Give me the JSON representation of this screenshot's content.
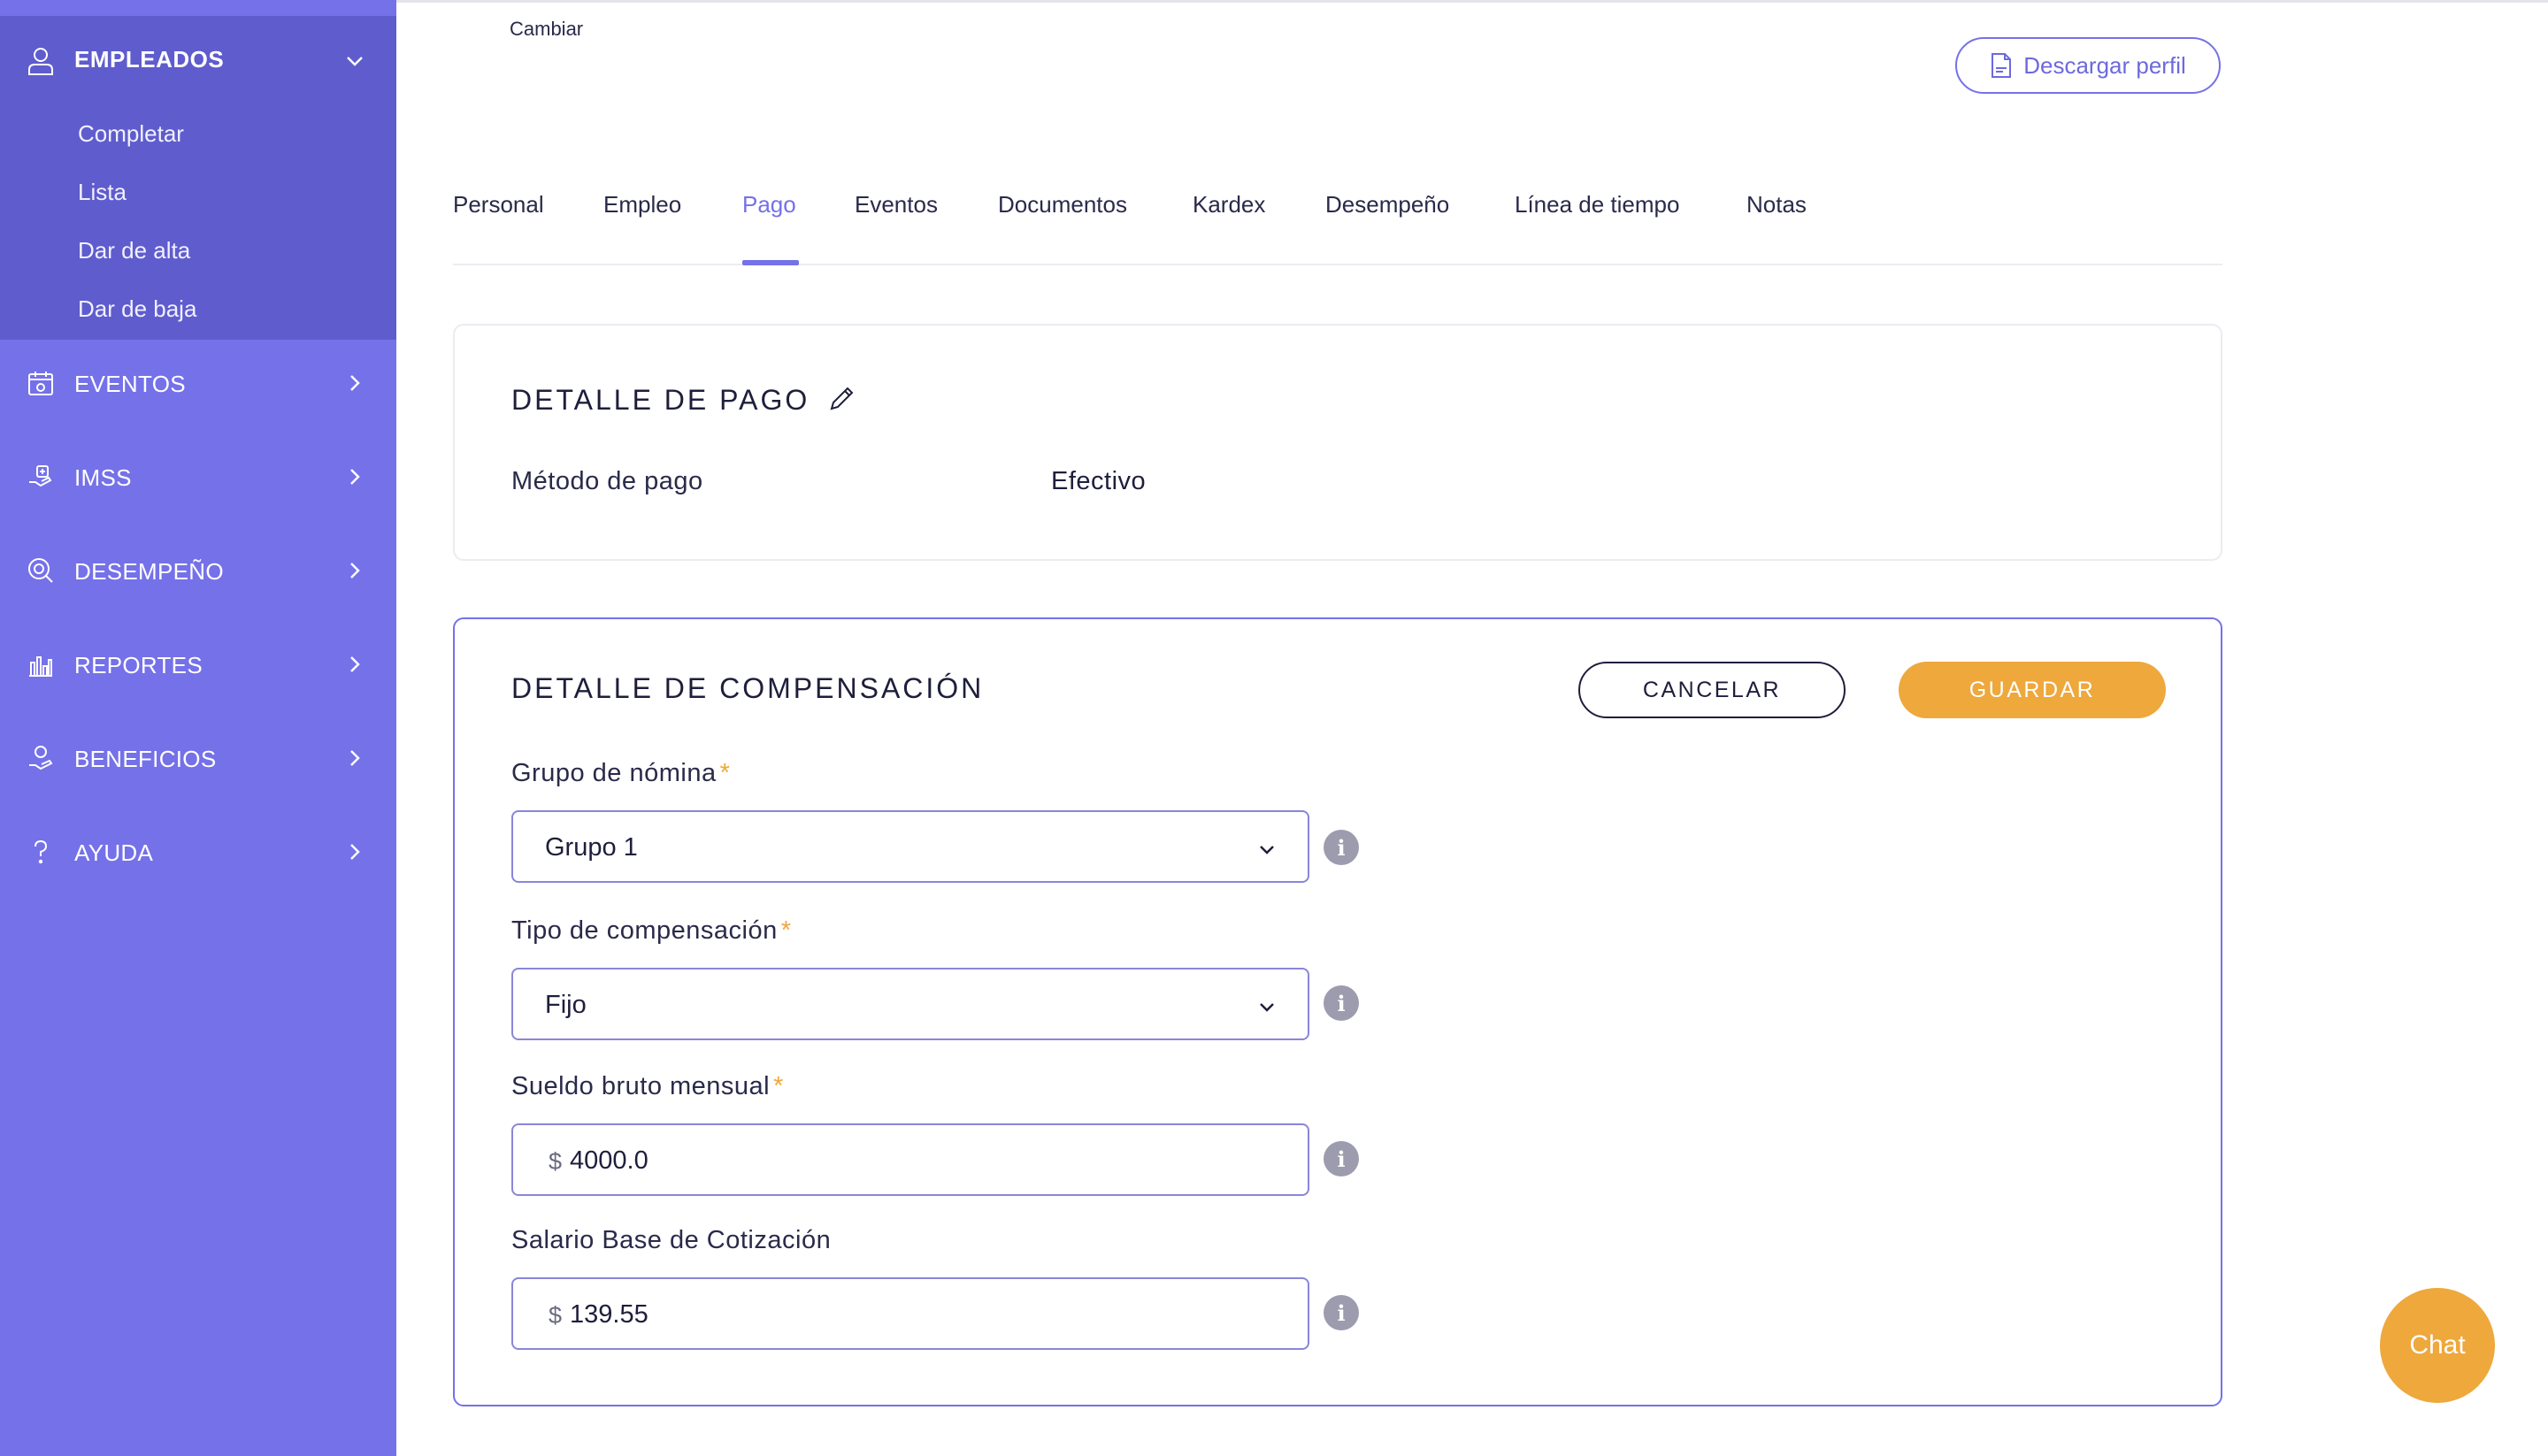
{
  "sidebar": {
    "empleados": {
      "label": "EMPLEADOS",
      "icon": "user-icon",
      "sub_items": [
        "Completar",
        "Lista",
        "Dar de alta",
        "Dar de baja"
      ]
    },
    "items": [
      {
        "label": "EVENTOS",
        "icon": "calendar-icon"
      },
      {
        "label": "IMSS",
        "icon": "medical-hand-icon"
      },
      {
        "label": "DESEMPEÑO",
        "icon": "target-search-icon"
      },
      {
        "label": "REPORTES",
        "icon": "bar-chart-icon"
      },
      {
        "label": "BENEFICIOS",
        "icon": "benefits-hand-icon"
      },
      {
        "label": "AYUDA",
        "icon": "help-question-icon"
      }
    ]
  },
  "header": {
    "cambiar": "Cambiar",
    "download_label": "Descargar perfil"
  },
  "tabs": [
    "Personal",
    "Empleo",
    "Pago",
    "Eventos",
    "Documentos",
    "Kardex",
    "Desempeño",
    "Línea de tiempo",
    "Notas"
  ],
  "active_tab": "Pago",
  "payment": {
    "title": "DETALLE DE PAGO",
    "method_label": "Método de pago",
    "method_value": "Efectivo"
  },
  "compensation": {
    "title": "DETALLE DE COMPENSACIÓN",
    "cancel_label": "CANCELAR",
    "save_label": "GUARDAR",
    "fields": {
      "group": {
        "label": "Grupo de nómina",
        "required": "*",
        "value": "Grupo 1"
      },
      "type": {
        "label": "Tipo de compensación",
        "required": "*",
        "value": "Fijo"
      },
      "salary": {
        "label": "Sueldo bruto mensual",
        "required": "*",
        "currency": "$",
        "value": "4000.0"
      },
      "sbc": {
        "label": "Salario Base de Cotización",
        "currency": "$",
        "value": "139.55"
      }
    }
  },
  "chat_label": "Chat",
  "colors": {
    "sidebar": "#7571e8",
    "sidebar_active": "#5f5ccd",
    "accent": "#7571e8",
    "save": "#eea83c"
  }
}
